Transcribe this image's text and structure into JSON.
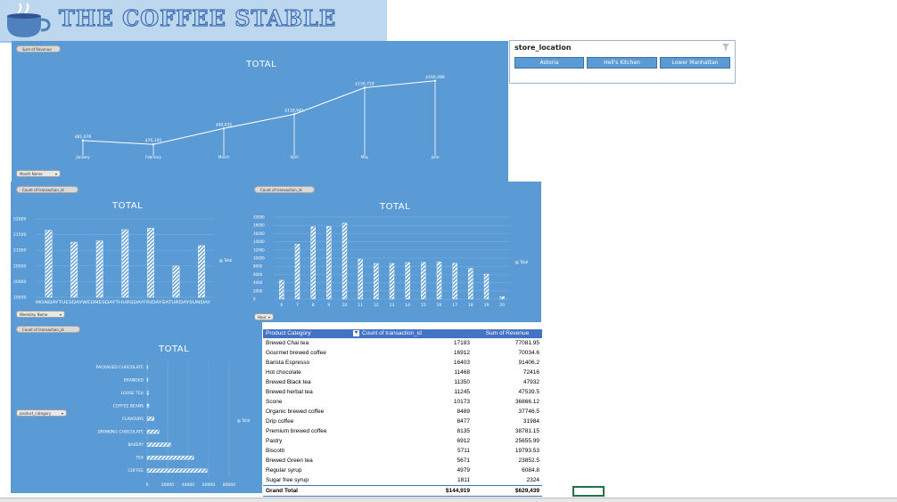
{
  "banner": {
    "title": "THE COFFEE STABLE",
    "bg": "#bdd7ee",
    "title_color": "#3f6fb4"
  },
  "colors": {
    "panel": "#5b9bd5",
    "header": "#4472c4",
    "selection": "#217346"
  },
  "revenue_chart": {
    "field_button": "Sum of Revenue",
    "filter_button": "Month Name",
    "title": "TOTAL",
    "chart_data": {
      "type": "line",
      "categories": [
        "January",
        "February",
        "March",
        "April",
        "May",
        "June"
      ],
      "values": [
        81678,
        76145,
        98835,
        118941,
        156728,
        166486
      ],
      "labels": [
        "$81,678",
        "$76,145",
        "$98,835",
        "$118,941",
        "$156,728",
        "$166,486"
      ],
      "title": "TOTAL"
    }
  },
  "weekday_chart": {
    "field_button": "Count of transaction_id",
    "filter_button": "Weekday Name",
    "title": "TOTAL",
    "legend": "Total",
    "chart_data": {
      "type": "bar",
      "categories": [
        "MONDAY",
        "TUESDAY",
        "WEDNESDAY",
        "THURSDAY",
        "FRIDAY",
        "SATURDAY",
        "SUNDAY"
      ],
      "values": [
        21640,
        21260,
        21300,
        21660,
        21710,
        20500,
        21150
      ],
      "yticks": [
        "22000",
        "21500",
        "21000",
        "20500",
        "20000",
        "19500"
      ],
      "ylim": [
        19500,
        22000
      ],
      "axis_text": "MONDAYTUESDAYWEDNESDAYTHURSDAYFRIDAYSATURDAYSUNDAY"
    }
  },
  "hour_chart": {
    "field_button": "Count of transaction_id",
    "filter_button": "Hour",
    "title": "TOTAL",
    "legend": "Total",
    "chart_data": {
      "type": "bar",
      "categories": [
        "6",
        "7",
        "8",
        "9",
        "10",
        "11",
        "12",
        "13",
        "14",
        "15",
        "16",
        "17",
        "18",
        "19",
        "20"
      ],
      "values": [
        4594,
        13428,
        17654,
        17764,
        18545,
        9766,
        8708,
        8714,
        8933,
        8979,
        9093,
        8745,
        7498,
        6092,
        603
      ],
      "yticks": [
        "20000",
        "18000",
        "16000",
        "14000",
        "12000",
        "10000",
        "8000",
        "6000",
        "4000",
        "2000",
        "0"
      ],
      "ylim": [
        0,
        20000
      ]
    }
  },
  "category_chart": {
    "field_button": "Count of transaction_id",
    "filter_button": "product_category",
    "title": "TOTAL",
    "legend": "Total",
    "chart_data": {
      "type": "bar",
      "orientation": "horizontal",
      "categories": [
        "PACKAGED CHOCOLATE",
        "BRANDED",
        "LOOSE TEA",
        "COFFEE BEANS",
        "FLAVOURS",
        "DRINKING CHOCOLATE",
        "BAKERY",
        "TEA",
        "COFFEE"
      ],
      "values": [
        487,
        747,
        1210,
        1753,
        6790,
        11468,
        22796,
        45449,
        58416
      ],
      "xticks": [
        "0",
        "20000",
        "40000",
        "60000",
        "80000"
      ],
      "xlim": [
        0,
        80000
      ]
    }
  },
  "slicer": {
    "title": "store_location",
    "items": [
      "Astoria",
      "Hell's Kitchen",
      "Lower Manhattan"
    ]
  },
  "pivot": {
    "headers": [
      "Product Category",
      "Count of transaction_id",
      "Sum of Revenue"
    ],
    "rows": [
      [
        "Brewed Chai tea",
        "17183",
        "77081.95"
      ],
      [
        "Gourmet brewed coffee",
        "16912",
        "70034.6"
      ],
      [
        "Barista Espresso",
        "16403",
        "91406.2"
      ],
      [
        "Hot chocolate",
        "11468",
        "72416"
      ],
      [
        "Brewed Black tea",
        "11350",
        "47932"
      ],
      [
        "Brewed herbal tea",
        "11245",
        "47539.5"
      ],
      [
        "Scone",
        "10173",
        "36866.12"
      ],
      [
        "Organic brewed coffee",
        "8489",
        "37746.5"
      ],
      [
        "Drip coffee",
        "8477",
        "31984"
      ],
      [
        "Premium brewed coffee",
        "8135",
        "38781.15"
      ],
      [
        "Pastry",
        "6912",
        "25655.99"
      ],
      [
        "Biscotti",
        "5711",
        "19793.53"
      ],
      [
        "Brewed Green tea",
        "5671",
        "23852.5"
      ],
      [
        "Regular syrup",
        "4979",
        "6084.8"
      ],
      [
        "Sugar free syrup",
        "1811",
        "2324"
      ]
    ],
    "total": [
      "Grand Total",
      "$144,919",
      "$629,439"
    ]
  }
}
